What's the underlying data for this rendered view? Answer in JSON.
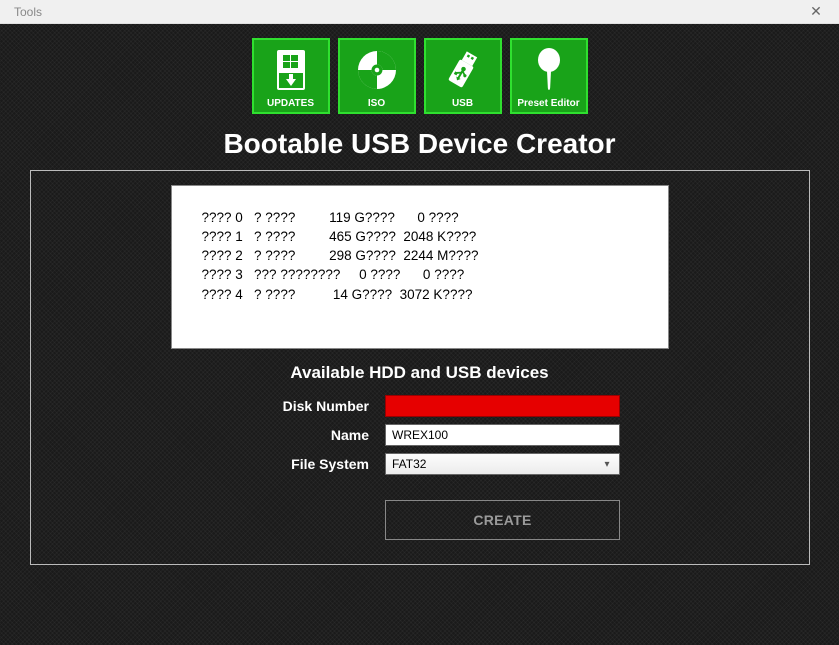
{
  "window": {
    "menu": {
      "tools": "Tools"
    }
  },
  "tiles": [
    {
      "label": "UPDATES"
    },
    {
      "label": "ISO"
    },
    {
      "label": "USB"
    },
    {
      "label": "Preset Editor"
    }
  ],
  "title": "Bootable USB Device Creator",
  "device_list": {
    "rows": [
      "???? 0   ? ????         119 G????      0 ????",
      "???? 1   ? ????         465 G????  2048 K????",
      "???? 2   ? ????         298 G????  2244 M????",
      "???? 3   ??? ????????     0 ????      0 ????",
      "???? 4   ? ????          14 G????  3072 K????"
    ]
  },
  "section_heading": "Available HDD and USB devices",
  "form": {
    "disk_number": {
      "label": "Disk Number",
      "value": ""
    },
    "name": {
      "label": "Name",
      "value": "WREX100"
    },
    "file_system": {
      "label": "File System",
      "value": "FAT32"
    },
    "create_label": "CREATE"
  },
  "colors": {
    "tile_bg": "#19a319",
    "tile_border": "#2fe02f",
    "error_bg": "#e60000"
  }
}
